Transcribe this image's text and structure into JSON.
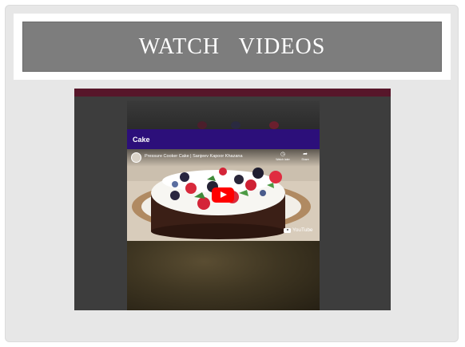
{
  "slide": {
    "title": "WATCH   VIDEOS"
  },
  "embed": {
    "header_label": "Cake",
    "video_title": "Pressure Cooker Cake | Sanjeev Kapoor Khazana",
    "actions": [
      {
        "label": "Watch later",
        "icon": "clock-icon"
      },
      {
        "label": "Share",
        "icon": "share-icon"
      }
    ],
    "brand": "YouTube"
  },
  "colors": {
    "title_bar": "#7d7d7d",
    "header_bar": "#2c0f7a",
    "strip": "#57162a",
    "play_button": "#ff0000"
  }
}
